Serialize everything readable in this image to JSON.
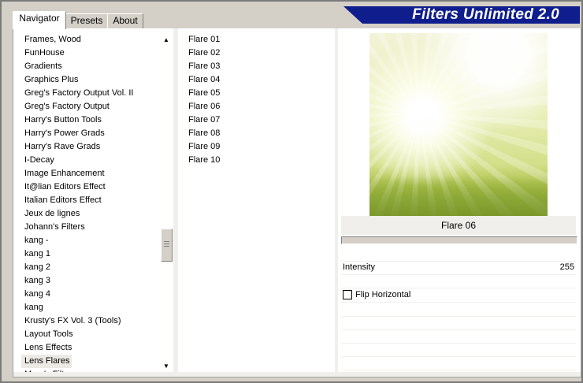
{
  "window": {
    "title": "Filters Unlimited 2.0"
  },
  "tabs": [
    {
      "label": "Navigator",
      "active": true
    },
    {
      "label": "Presets",
      "active": false
    },
    {
      "label": "About",
      "active": false
    }
  ],
  "categories": [
    "Frames, Wood",
    "FunHouse",
    "Gradients",
    "Graphics Plus",
    "Greg's Factory Output Vol. II",
    "Greg's Factory Output",
    "Harry's Button Tools",
    "Harry's Power Grads",
    "Harry's Rave Grads",
    "I-Decay",
    "Image Enhancement",
    "It@lian Editors Effect",
    "Italian Editors Effect",
    "Jeux de lignes",
    "Johann's Filters",
    "kang -",
    "kang 1",
    "kang 2",
    "kang 3",
    "kang 4",
    "kang",
    "Krusty's FX Vol. 3 (Tools)",
    "Layout Tools",
    "Lens Effects",
    "Lens Flares",
    "Mura's Filters"
  ],
  "selected_category": "Lens Flares",
  "filters": [
    "Flare 01",
    "Flare 02",
    "Flare 03",
    "Flare 04",
    "Flare 05",
    "Flare 06",
    "Flare 07",
    "Flare 08",
    "Flare 09",
    "Flare 10"
  ],
  "selected_filter": "Flare 06",
  "params": {
    "intensity_label": "Intensity",
    "intensity_value": "255",
    "flip_label": "Flip Horizontal",
    "flip_checked": false
  },
  "colors": {
    "banner": "#0f1e8c",
    "background": "#d4d0c8"
  },
  "scroll": {
    "position_fraction": 0.6
  }
}
